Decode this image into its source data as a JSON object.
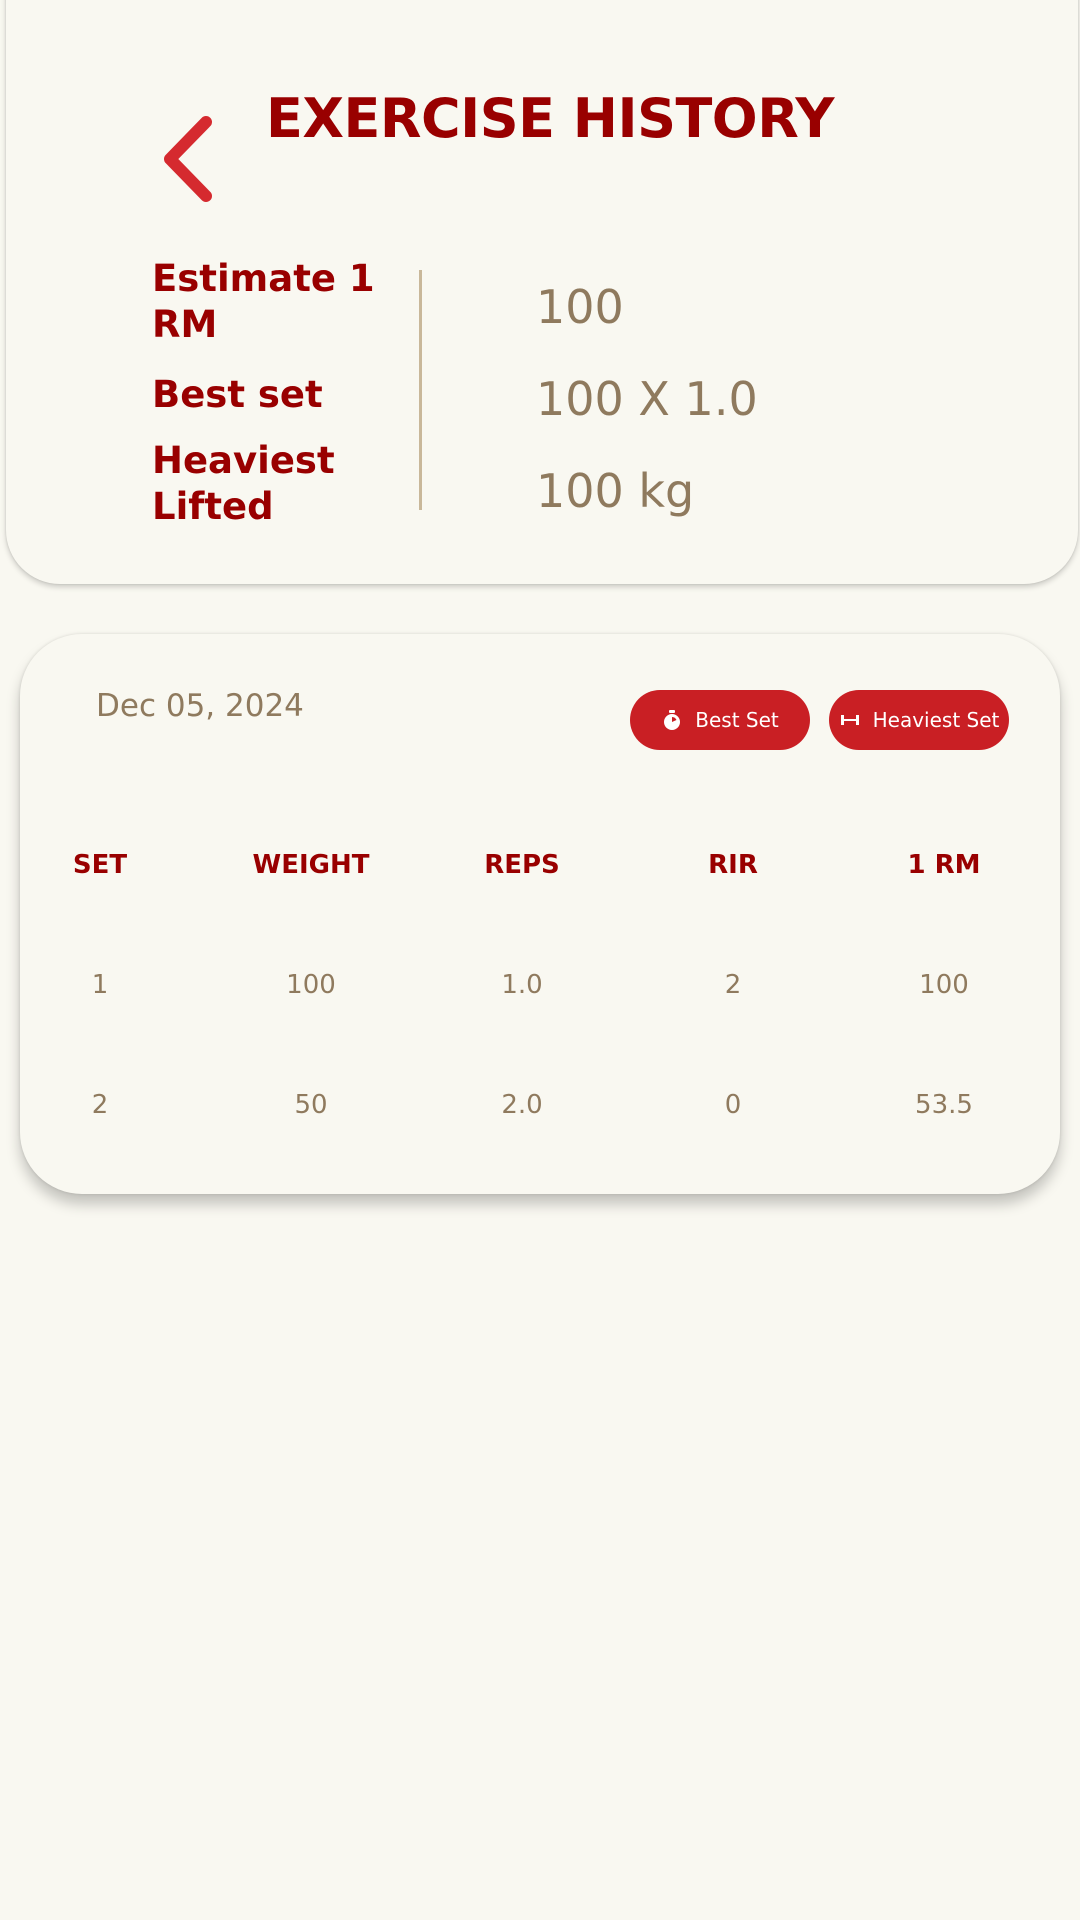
{
  "header": {
    "title": "EXERCISE HISTORY",
    "back_icon": "chevron-left-icon"
  },
  "stats": [
    {
      "label": "Estimate 1 RM",
      "value": "100"
    },
    {
      "label": "Best set",
      "value": "100 X 1.0"
    },
    {
      "label": "Heaviest Lifted",
      "value": "100 kg"
    }
  ],
  "session": {
    "date": "Dec 05, 2024",
    "best_set_label": "Best Set",
    "best_set_icon": "stopwatch-icon",
    "heaviest_set_label": "Heaviest Set",
    "heaviest_set_icon": "dumbbell-icon",
    "columns": [
      "SET",
      "WEIGHT",
      "REPS",
      "RIR",
      "1 RM"
    ],
    "rows": [
      [
        "1",
        "100",
        "1.0",
        "2",
        "100"
      ],
      [
        "2",
        "50",
        "2.0",
        "0",
        "53.5"
      ]
    ]
  },
  "colors": {
    "background": "#f9f8f1",
    "title": "#990000",
    "value": "#8f7a5e",
    "accent": "#c91f24"
  }
}
